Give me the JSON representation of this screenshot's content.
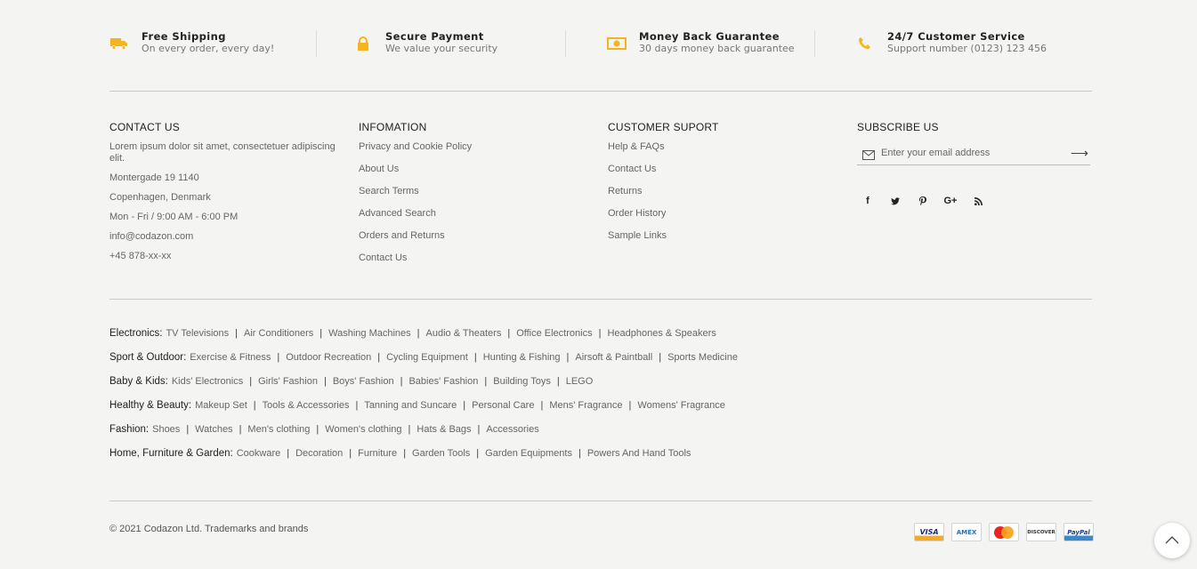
{
  "features": [
    {
      "icon": "truck-icon",
      "title": "Free Shipping",
      "subtitle": "On every order, every day!"
    },
    {
      "icon": "lock-icon",
      "title": "Secure Payment",
      "subtitle": "We value your security"
    },
    {
      "icon": "money-icon",
      "title": "Money Back Guarantee",
      "subtitle": "30 days money back guarantee"
    },
    {
      "icon": "phone-icon",
      "title": "24/7 Customer Service",
      "subtitle": "Support number (0123) 123 456"
    }
  ],
  "accent_color": "#f5b31f",
  "contact": {
    "heading": "CONTACT US",
    "lines": [
      "Lorem ipsum dolor sit amet, consectetuer adipiscing elit.",
      "Montergade 19 1140",
      "Copenhagen, Denmark",
      "Mon - Fri / 9:00 AM - 6:00 PM",
      "info@codazon.com",
      "+45 878-xx-xx"
    ]
  },
  "information": {
    "heading": "INFOMATION",
    "links": [
      "Privacy and Cookie Policy",
      "About Us",
      "Search Terms",
      "Advanced Search",
      "Orders and Returns",
      "Contact Us"
    ]
  },
  "support": {
    "heading": "CUSTOMER SUPORT",
    "links": [
      "Help & FAQs",
      "Contact Us",
      "Returns",
      "Order History",
      "Sample Links"
    ]
  },
  "subscribe": {
    "heading": "SUBSCRIBE US",
    "placeholder": "Enter your email address",
    "social": [
      {
        "icon": "facebook-icon",
        "glyph": "f"
      },
      {
        "icon": "twitter-icon",
        "glyph": "t"
      },
      {
        "icon": "pinterest-icon",
        "glyph": "p"
      },
      {
        "icon": "google-plus-icon",
        "glyph": "G+"
      },
      {
        "icon": "rss-icon",
        "glyph": "rss"
      }
    ]
  },
  "categories": [
    {
      "name": "Electronics:",
      "links": [
        "TV Televisions",
        "Air Conditioners",
        "Washing Machines",
        "Audio & Theaters",
        "Office Electronics",
        "Headphones & Speakers"
      ]
    },
    {
      "name": "Sport & Outdoor:",
      "links": [
        "Exercise & Fitness",
        "Outdoor Recreation",
        "Cycling Equipment",
        "Hunting & Fishing",
        "Airsoft & Paintball",
        "Sports Medicine"
      ]
    },
    {
      "name": "Baby & Kids:",
      "links": [
        "Kids' Electronics",
        "Girls' Fashion",
        "Boys' Fashion",
        "Babies' Fashion",
        "Building Toys",
        "LEGO"
      ]
    },
    {
      "name": "Healthy & Beauty:",
      "links": [
        "Makeup Set",
        "Tools & Accessories",
        "Tanning and Suncare",
        "Personal Care",
        "Mens' Fragrance",
        "Womens' Fragrance"
      ]
    },
    {
      "name": "Fashion:",
      "links": [
        "Shoes",
        "Watches",
        "Men's clothing",
        "Women's clothing",
        "Hats & Bags",
        "Accessories"
      ]
    },
    {
      "name": "Home, Furniture & Garden:",
      "links": [
        "Cookware",
        "Decoration",
        "Furniture",
        "Garden Tools",
        "Garden Equipments",
        "Powers And Hand Tools"
      ]
    }
  ],
  "separator": "|",
  "copyright": "© 2021 Codazon Ltd. Trademarks and brands",
  "payments": [
    {
      "name": "visa",
      "label": "VISA"
    },
    {
      "name": "amex",
      "label": "AMEX"
    },
    {
      "name": "mastercard",
      "label": "MasterCard"
    },
    {
      "name": "discover",
      "label": "DISCOVER"
    },
    {
      "name": "paypal",
      "label": "PayPal"
    }
  ]
}
